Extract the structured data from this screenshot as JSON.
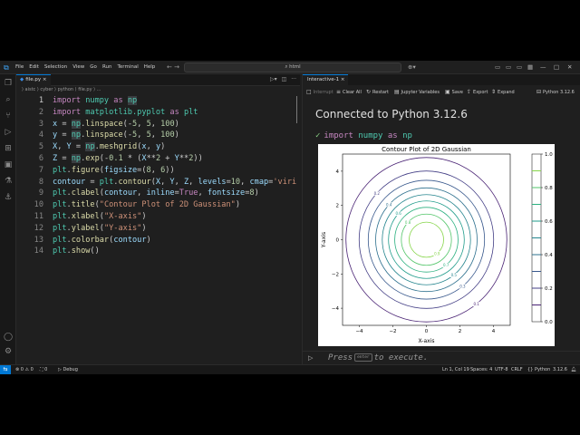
{
  "titlebar": {
    "menu": [
      "File",
      "Edit",
      "Selection",
      "View",
      "Go",
      "Run",
      "Terminal",
      "Help"
    ],
    "search": "html"
  },
  "editor": {
    "tab": "file.py",
    "breadcrumb": "⟩ aistc ⟩ cyber ⟩ python ⟩ file.py ⟩ ...",
    "lines": [
      {
        "n": "1",
        "html": "<span class=\"kw\">import</span> <span class=\"mod\">numpy</span> <span class=\"kw\">as</span> <span class=\"mod hl\">np</span>"
      },
      {
        "n": "2",
        "html": "<span class=\"kw\">import</span> <span class=\"mod\">matplotlib.pyplot</span> <span class=\"kw\">as</span> <span class=\"mod\">plt</span>"
      },
      {
        "n": "3",
        "html": "<span class=\"var\">x</span> = <span class=\"mod hl\">np</span>.<span class=\"fn\">linspace</span>(-<span class=\"num\">5</span>, <span class=\"num\">5</span>, <span class=\"num\">100</span>)"
      },
      {
        "n": "4",
        "html": "<span class=\"var\">y</span> = <span class=\"mod hl\">np</span>.<span class=\"fn\">linspace</span>(-<span class=\"num\">5</span>, <span class=\"num\">5</span>, <span class=\"num\">100</span>)"
      },
      {
        "n": "5",
        "html": "<span class=\"var\">X</span>, <span class=\"var\">Y</span> = <span class=\"mod hl\">np</span>.<span class=\"fn\">meshgrid</span>(<span class=\"var\">x</span>, <span class=\"var\">y</span>)"
      },
      {
        "n": "6",
        "html": "<span class=\"var\">Z</span> = <span class=\"mod hl\">np</span>.<span class=\"fn\">exp</span>(-<span class=\"num\">0.1</span> * (<span class=\"var\">X</span>**<span class=\"num\">2</span> + <span class=\"var\">Y</span>**<span class=\"num\">2</span>))"
      },
      {
        "n": "7",
        "html": "<span class=\"mod\">plt</span>.<span class=\"fn\">figure</span>(<span class=\"var\">figsize</span>=(<span class=\"num\">8</span>, <span class=\"num\">6</span>))"
      },
      {
        "n": "8",
        "html": "<span class=\"var\">contour</span> = <span class=\"mod\">plt</span>.<span class=\"fn\">contour</span>(<span class=\"var\">X</span>, <span class=\"var\">Y</span>, <span class=\"var\">Z</span>, <span class=\"var\">levels</span>=<span class=\"num\">10</span>, <span class=\"var\">cmap</span>=<span class=\"str\">'viri</span>"
      },
      {
        "n": "9",
        "html": "<span class=\"mod\">plt</span>.<span class=\"fn\">clabel</span>(<span class=\"var\">contour</span>, <span class=\"var\">inline</span>=<span class=\"kw\">True</span>, <span class=\"var\">fontsize</span>=<span class=\"num\">8</span>)"
      },
      {
        "n": "10",
        "html": "<span class=\"mod\">plt</span>.<span class=\"fn\">title</span>(<span class=\"str\">\"Contour Plot of 2D Gaussian\"</span>)"
      },
      {
        "n": "11",
        "html": "<span class=\"mod\">plt</span>.<span class=\"fn\">xlabel</span>(<span class=\"str\">\"X-axis\"</span>)"
      },
      {
        "n": "12",
        "html": "<span class=\"mod\">plt</span>.<span class=\"fn\">ylabel</span>(<span class=\"str\">\"Y-axis\"</span>)"
      },
      {
        "n": "13",
        "html": "<span class=\"mod\">plt</span>.<span class=\"fn\">colorbar</span>(<span class=\"var\">contour</span>)"
      },
      {
        "n": "14",
        "html": "<span class=\"mod\">plt</span>.<span class=\"fn\">show</span>()"
      }
    ]
  },
  "panel": {
    "tab": "Interactive-1",
    "toolbar": {
      "interrupt": "Interrupt",
      "clear_all": "Clear All",
      "restart": "Restart",
      "variables": "Jupyter Variables",
      "save": "Save",
      "export": "Export",
      "expand": "Expand",
      "kernel": "Python 3.12.6"
    },
    "connected": "Connected to Python 3.12.6",
    "cell_code": "import numpy as np",
    "press_before": "Press",
    "press_key": "enter",
    "press_after": "to execute."
  },
  "status": {
    "errors": "0",
    "warnings": "0",
    "ports": "0",
    "debug": "Debug",
    "position": "Ln 1, Col 19",
    "spaces": "Spaces: 4",
    "encoding": "UTF-8",
    "eol": "CRLF",
    "language": "Python",
    "version": "3.12.6"
  },
  "chart_data": {
    "type": "contour",
    "title": "Contour Plot of 2D Gaussian",
    "xlabel": "X-axis",
    "ylabel": "Y-axis",
    "xlim": [
      -5,
      5
    ],
    "ylim": [
      -5,
      5
    ],
    "xticks": [
      -4,
      -2,
      0,
      2,
      4
    ],
    "yticks": [
      -4,
      -2,
      0,
      2,
      4
    ],
    "levels": [
      0.1,
      0.2,
      0.3,
      0.4,
      0.5,
      0.6,
      0.7,
      0.8,
      0.9
    ],
    "level_colors": [
      "#482173",
      "#433e85",
      "#38588c",
      "#2d708e",
      "#25858e",
      "#1e9b8a",
      "#2ab07f",
      "#52c569",
      "#86d549"
    ],
    "colorbar_ticks": [
      "0.0",
      "0.2",
      "0.4",
      "0.6",
      "0.8",
      "1.0"
    ],
    "colorbar_range": [
      0,
      1.0
    ]
  }
}
